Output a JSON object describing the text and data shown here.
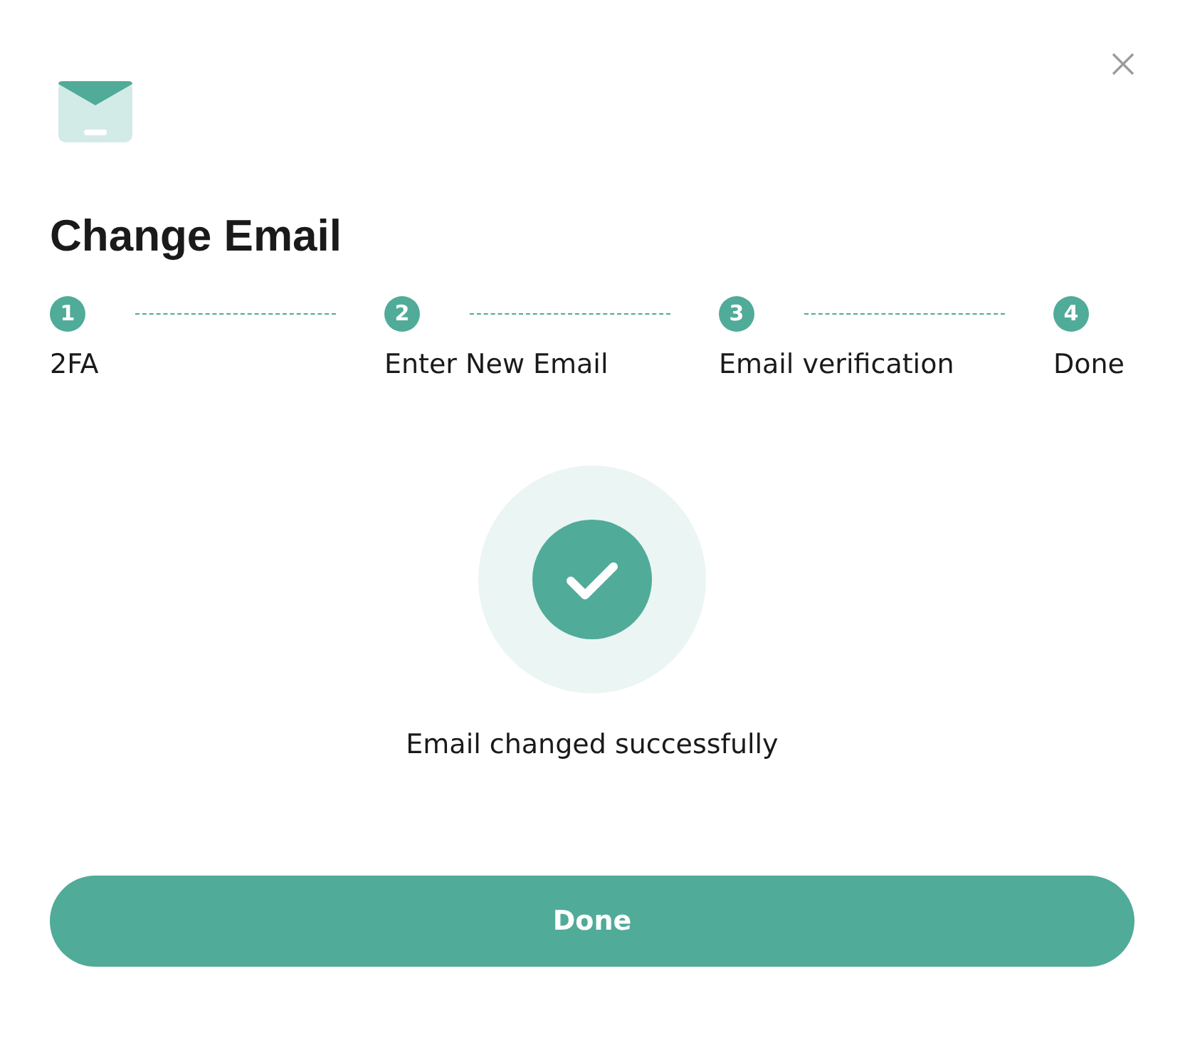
{
  "dialog": {
    "title": "Change Email"
  },
  "steps": [
    {
      "number": "1",
      "label": "2FA",
      "completed": true
    },
    {
      "number": "2",
      "label": "Enter New Email",
      "completed": true
    },
    {
      "number": "3",
      "label": "Email verification",
      "completed": true
    },
    {
      "number": "4",
      "label": "Done",
      "completed": true
    }
  ],
  "result": {
    "message": "Email changed successfully"
  },
  "button": {
    "label": "Done"
  }
}
